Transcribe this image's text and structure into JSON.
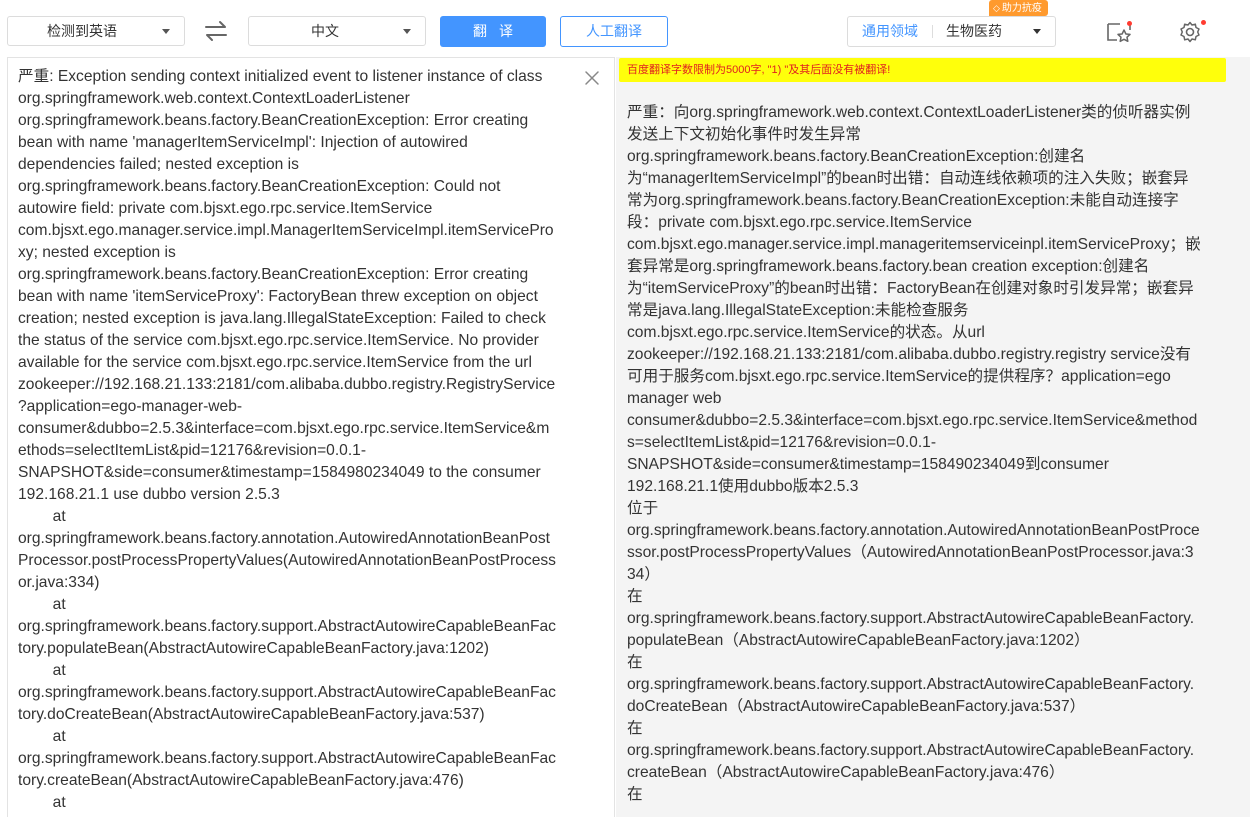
{
  "toolbar": {
    "source_language": "检测到英语",
    "target_language": "中文",
    "translate_label": "翻译",
    "human_translate_label": "人工翻译",
    "domain_general": "通用领域",
    "domain_selected": "生物医药",
    "badge_text": "助力抗疫",
    "accent_color": "#4395ff"
  },
  "warning": {
    "text": "百度翻译字数限制为5000字, \"1) \"及其后面没有被翻译!"
  },
  "source": {
    "lines": [
      "严重: Exception sending context initialized event to listener instance of class",
      "org.springframework.web.context.ContextLoaderListener",
      "org.springframework.beans.factory.BeanCreationException: Error creating",
      "bean with name 'managerItemServiceImpl': Injection of autowired",
      "dependencies failed; nested exception is",
      "org.springframework.beans.factory.BeanCreationException: Could not",
      "autowire field: private com.bjsxt.ego.rpc.service.ItemService",
      "com.bjsxt.ego.manager.service.impl.ManagerItemServiceImpl.itemServicePro",
      "xy; nested exception is",
      "org.springframework.beans.factory.BeanCreationException: Error creating",
      "bean with name 'itemServiceProxy': FactoryBean threw exception on object",
      "creation; nested exception is java.lang.IllegalStateException: Failed to check",
      "the status of the service com.bjsxt.ego.rpc.service.ItemService. No provider",
      "available for the service com.bjsxt.ego.rpc.service.ItemService from the url",
      "zookeeper://192.168.21.133:2181/com.alibaba.dubbo.registry.RegistryService",
      "?application=ego-manager-web-",
      "consumer&dubbo=2.5.3&interface=com.bjsxt.ego.rpc.service.ItemService&m",
      "ethods=selectItemList&pid=12176&revision=0.0.1-",
      "SNAPSHOT&side=consumer&timestamp=1584980234049 to the consumer",
      "192.168.21.1 use dubbo version 2.5.3",
      "        at",
      "org.springframework.beans.factory.annotation.AutowiredAnnotationBeanPost",
      "Processor.postProcessPropertyValues(AutowiredAnnotationBeanPostProcess",
      "or.java:334)",
      "        at",
      "org.springframework.beans.factory.support.AbstractAutowireCapableBeanFac",
      "tory.populateBean(AbstractAutowireCapableBeanFactory.java:1202)",
      "        at",
      "org.springframework.beans.factory.support.AbstractAutowireCapableBeanFac",
      "tory.doCreateBean(AbstractAutowireCapableBeanFactory.java:537)",
      "        at",
      "org.springframework.beans.factory.support.AbstractAutowireCapableBeanFac",
      "tory.createBean(AbstractAutowireCapableBeanFactory.java:476)",
      "        at"
    ]
  },
  "target": {
    "lines": [
      "严重：向org.springframework.web.context.ContextLoaderListener类的侦听器实例",
      "发送上下文初始化事件时发生异常",
      "org.springframework.beans.factory.BeanCreationException:创建名",
      "为“managerItemServiceImpl”的bean时出错：自动连线依赖项的注入失败；嵌套异",
      "常为org.springframework.beans.factory.BeanCreationException:未能自动连接字",
      "段：private com.bjsxt.ego.rpc.service.ItemService",
      "com.bjsxt.ego.manager.service.impl.manageritemserviceinpl.itemServiceProxy；嵌",
      "套异常是org.springframework.beans.factory.bean creation exception:创建名",
      "为“itemServiceProxy”的bean时出错：FactoryBean在创建对象时引发异常；嵌套异",
      "常是java.lang.IllegalStateException:未能检查服务",
      "com.bjsxt.ego.rpc.service.ItemService的状态。从url",
      "zookeeper://192.168.21.133:2181/com.alibaba.dubbo.registry.registry service没有",
      "可用于服务com.bjsxt.ego.rpc.service.ItemService的提供程序？application=ego",
      "manager web",
      "consumer&dubbo=2.5.3&interface=com.bjsxt.ego.rpc.service.ItemService&method",
      "s=selectItemList&pid=12176&revision=0.0.1-",
      "SNAPSHOT&side=consumer&timestamp=158490234049到consumer",
      "192.168.21.1使用dubbo版本2.5.3",
      "位于",
      "org.springframework.beans.factory.annotation.AutowiredAnnotationBeanPostProce",
      "ssor.postProcessPropertyValues（AutowiredAnnotationBeanPostProcessor.java:3",
      "34）",
      "在",
      "org.springframework.beans.factory.support.AbstractAutowireCapableBeanFactory.",
      "populateBean（AbstractAutowireCapableBeanFactory.java:1202）",
      "在",
      "org.springframework.beans.factory.support.AbstractAutowireCapableBeanFactory.",
      "doCreateBean（AbstractAutowireCapableBeanFactory.java:537）",
      "在",
      "org.springframework.beans.factory.support.AbstractAutowireCapableBeanFactory.",
      "createBean（AbstractAutowireCapableBeanFactory.java:476）",
      "在"
    ]
  },
  "icons": {
    "swap": "swap-arrows-icon",
    "favorites": "favorite-star-icon",
    "settings": "gear-icon",
    "close": "close-icon"
  }
}
